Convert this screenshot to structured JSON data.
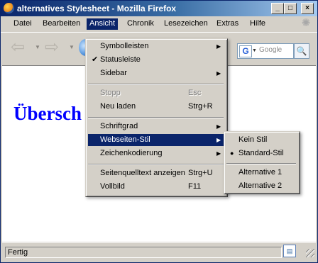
{
  "window": {
    "title": "alternatives Stylesheet - Mozilla Firefox"
  },
  "title_buttons": {
    "minimize": "_",
    "maximize": "□",
    "close": "×"
  },
  "menubar": [
    {
      "label": "Datei"
    },
    {
      "label": "Bearbeiten"
    },
    {
      "label": "Ansicht"
    },
    {
      "label": "Chronik"
    },
    {
      "label": "Lesezeichen"
    },
    {
      "label": "Extras"
    },
    {
      "label": "Hilfe"
    }
  ],
  "toolbar": {
    "back": "⇦",
    "forward": "⇨",
    "search_engine_icon": "G",
    "search_placeholder": "Google",
    "search_go": "🔍"
  },
  "page": {
    "heading": "Übersch"
  },
  "status": {
    "text": "Fertig"
  },
  "view_menu": {
    "items": [
      {
        "label": "Symbolleisten",
        "shortcut": "",
        "submenu": true,
        "checked": false,
        "disabled": false
      },
      {
        "label": "Statusleiste",
        "shortcut": "",
        "submenu": false,
        "checked": true,
        "disabled": false
      },
      {
        "label": "Sidebar",
        "shortcut": "",
        "submenu": true,
        "checked": false,
        "disabled": false
      },
      {
        "label": "Stopp",
        "shortcut": "Esc",
        "submenu": false,
        "checked": false,
        "disabled": true
      },
      {
        "label": "Neu laden",
        "shortcut": "Strg+R",
        "submenu": false,
        "checked": false,
        "disabled": false
      },
      {
        "label": "Schriftgrad",
        "shortcut": "",
        "submenu": true,
        "checked": false,
        "disabled": false
      },
      {
        "label": "Webseiten-Stil",
        "shortcut": "",
        "submenu": true,
        "checked": false,
        "disabled": false,
        "highlighted": true
      },
      {
        "label": "Zeichenkodierung",
        "shortcut": "",
        "submenu": true,
        "checked": false,
        "disabled": false
      },
      {
        "label": "Seitenquelltext anzeigen",
        "shortcut": "Strg+U",
        "submenu": false,
        "checked": false,
        "disabled": false
      },
      {
        "label": "Vollbild",
        "shortcut": "F11",
        "submenu": false,
        "checked": false,
        "disabled": false
      }
    ]
  },
  "style_submenu": {
    "items": [
      {
        "label": "Kein Stil",
        "selected": false
      },
      {
        "label": "Standard-Stil",
        "selected": true
      },
      {
        "label": "Alternative 1",
        "selected": false
      },
      {
        "label": "Alternative 2",
        "selected": false
      }
    ]
  },
  "colors": {
    "menu_highlight": "#0a246a",
    "heading": "#0000ff",
    "titlebar_start": "#0a246a",
    "titlebar_end": "#a6caf0"
  }
}
